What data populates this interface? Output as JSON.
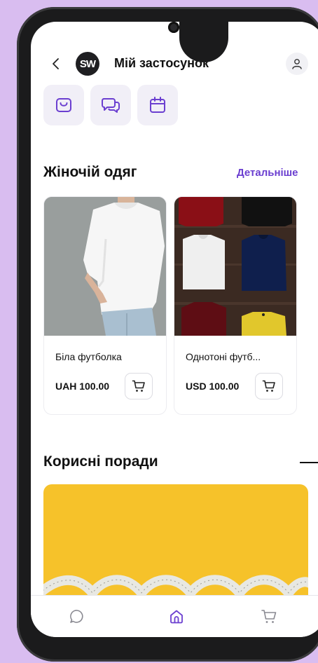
{
  "header": {
    "logo_text": "SW",
    "title": "Мій застосунок"
  },
  "quick_actions": [
    {
      "icon": "shopping-bag-icon"
    },
    {
      "icon": "chat-icon"
    },
    {
      "icon": "calendar-icon"
    }
  ],
  "women_section": {
    "title": "Жіночій одяг",
    "more_label": "Детальніше",
    "products": [
      {
        "name": "Біла футболка",
        "price": "UAH 100.00"
      },
      {
        "name": "Однотоні футб...",
        "price": "USD 100.00"
      }
    ]
  },
  "tips_section": {
    "title": "Корисні поради"
  },
  "bottom_nav": [
    {
      "icon": "chat-icon",
      "active": false
    },
    {
      "icon": "home-icon",
      "active": true
    },
    {
      "icon": "cart-icon",
      "active": false
    }
  ],
  "colors": {
    "background": "#d9bdf0",
    "accent": "#6b3fd0",
    "banner": "#f6c22a"
  }
}
